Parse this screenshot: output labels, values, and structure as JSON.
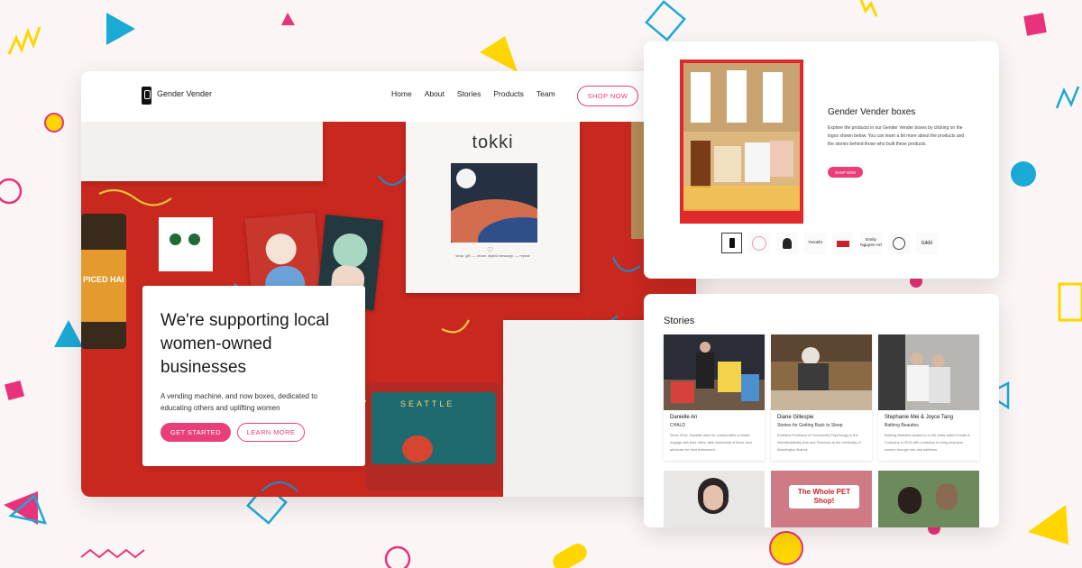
{
  "site": {
    "brand": "Gender Vender",
    "nav": [
      "Home",
      "About",
      "Stories",
      "Products",
      "Team"
    ],
    "shop_label": "SHOP NOW"
  },
  "hero": {
    "title": "We're supporting local women-owned businesses",
    "subtitle": "A vending machine, and now boxes, dedicated to educating others and uplifting women",
    "primary_button": "GET STARTED",
    "secondary_button": "LEARN MORE",
    "product_brand": "tokki",
    "product_caption": "wrap. gift. — reuse. digital message. — repeat",
    "chai_label": "PICED HAI",
    "bag_label": "SEATTLE"
  },
  "boxes": {
    "title": "Gender Vender boxes",
    "description": "Explore the products in our Gender Vender boxes by clicking on the logos shown below. You can learn a bit more about the products and the stories behind those who built these products.",
    "button": "SHOP NOW",
    "vendors": [
      "",
      "",
      "",
      "Yoroshi",
      "",
      "Emily Nguyen Art",
      "",
      "tokki"
    ]
  },
  "stories": {
    "title": "Stories",
    "items": [
      {
        "name": "Danielle An",
        "subtitle": "CHALD",
        "description": "Since 2016, Danielle aims for communities to better engage with their cities, take ownership of them, and advocate for their betterment."
      },
      {
        "name": "Diane Gillespie",
        "subtitle": "Stories for Getting Back to Sleep",
        "description": "Emeritus Professor of Community Psychology in the Interdisciplinary Arts and Sciences at the University of Washington Bothell."
      },
      {
        "name": "Stephanie Mei & Joyce Tang",
        "subtitle": "Bathing Beauties",
        "description": "Bathing Beauties started in a UW class called Create A Company in 2016 with a mission to bring empower women through rest and wellness."
      }
    ],
    "lower_sign": "The Whole PET Shop!"
  },
  "colors": {
    "accent": "#e83e7a",
    "hero_red": "#c9281f",
    "page_bg": "#fbf6f5",
    "deco_blue": "#1ba9d6",
    "deco_yellow": "#ffd600",
    "deco_pink": "#e8327a"
  }
}
